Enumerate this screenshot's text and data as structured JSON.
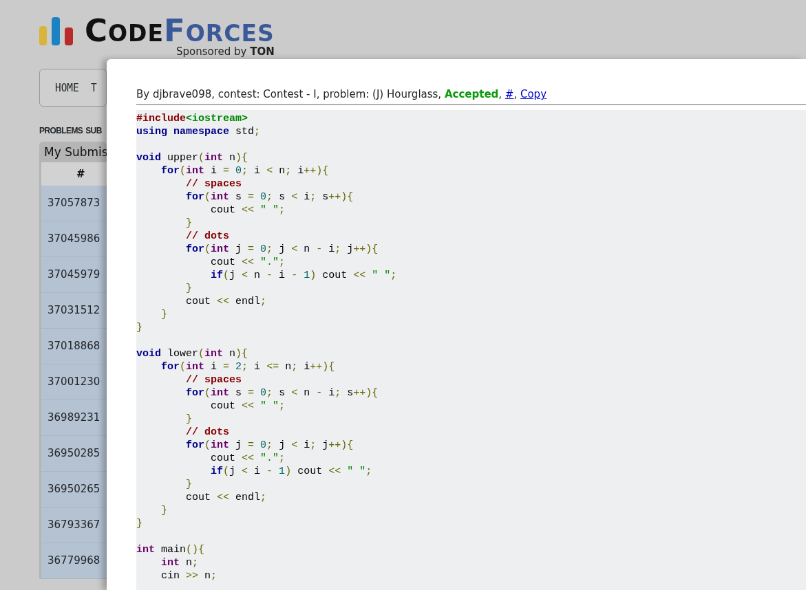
{
  "logo": {
    "word_dark": "CODE",
    "word_blue": "FORCES",
    "sponsor_prefix": "Sponsored by",
    "sponsor_name": "TON"
  },
  "menu": [
    {
      "label": "HOME"
    },
    {
      "label": "T"
    }
  ],
  "submenu": [
    {
      "label": "PROBLEMS"
    },
    {
      "label": "SUB"
    }
  ],
  "submissions": {
    "title": "My Submis",
    "columns": [
      "#"
    ],
    "rows": [
      {
        "id": "37057873"
      },
      {
        "id": "37045986"
      },
      {
        "id": "37045979"
      },
      {
        "id": "37031512"
      },
      {
        "id": "37018868"
      },
      {
        "id": "37001230"
      },
      {
        "id": "36989231"
      },
      {
        "id": "36950285"
      },
      {
        "id": "36950265"
      },
      {
        "id": "36793367"
      },
      {
        "id": "36779968"
      }
    ]
  },
  "modal": {
    "info": [
      {
        "kind": "text",
        "text": "By djbrave098, contest: Contest - I, problem: (J) Hourglass,"
      },
      {
        "kind": "verdict",
        "text": "Accepted"
      },
      {
        "kind": "text",
        "text": ","
      },
      {
        "kind": "link",
        "text": "#"
      },
      {
        "kind": "text",
        "text": ","
      },
      {
        "kind": "link",
        "text": "Copy"
      }
    ],
    "code": [
      {
        "kind": "code",
        "tokens": [
          {
            "kind": "pp",
            "text": "#include"
          },
          {
            "kind": "inc",
            "text": "<iostream>"
          }
        ]
      },
      {
        "kind": "code",
        "tokens": [
          {
            "kind": "kw",
            "text": "using namespace"
          },
          {
            "kind": "pln",
            "text": " std"
          },
          {
            "kind": "pun",
            "text": ";"
          }
        ]
      },
      {
        "kind": "blank"
      },
      {
        "kind": "code",
        "tokens": [
          {
            "kind": "kw",
            "text": "void"
          },
          {
            "kind": "pln",
            "text": " upper"
          },
          {
            "kind": "pun",
            "text": "("
          },
          {
            "kind": "typ",
            "text": "int"
          },
          {
            "kind": "pln",
            "text": " n"
          },
          {
            "kind": "pun",
            "text": "){"
          }
        ]
      },
      {
        "kind": "code",
        "tokens": [
          {
            "kind": "kw",
            "text": "    for"
          },
          {
            "kind": "pun",
            "text": "("
          },
          {
            "kind": "typ",
            "text": "int"
          },
          {
            "kind": "pln",
            "text": " i "
          },
          {
            "kind": "pun",
            "text": "="
          },
          {
            "kind": "num",
            "text": " 0"
          },
          {
            "kind": "pun",
            "text": ";"
          },
          {
            "kind": "pln",
            "text": " i "
          },
          {
            "kind": "pun",
            "text": "<"
          },
          {
            "kind": "pln",
            "text": " n"
          },
          {
            "kind": "pun",
            "text": ";"
          },
          {
            "kind": "pln",
            "text": " i"
          },
          {
            "kind": "pun",
            "text": "++){"
          }
        ]
      },
      {
        "kind": "code",
        "tokens": [
          {
            "kind": "com",
            "text": "        // spaces"
          }
        ]
      },
      {
        "kind": "code",
        "tokens": [
          {
            "kind": "kw",
            "text": "        for"
          },
          {
            "kind": "pun",
            "text": "("
          },
          {
            "kind": "typ",
            "text": "int"
          },
          {
            "kind": "pln",
            "text": " s "
          },
          {
            "kind": "pun",
            "text": "="
          },
          {
            "kind": "num",
            "text": " 0"
          },
          {
            "kind": "pun",
            "text": ";"
          },
          {
            "kind": "pln",
            "text": " s "
          },
          {
            "kind": "pun",
            "text": "<"
          },
          {
            "kind": "pln",
            "text": " i"
          },
          {
            "kind": "pun",
            "text": ";"
          },
          {
            "kind": "pln",
            "text": " s"
          },
          {
            "kind": "pun",
            "text": "++){"
          }
        ]
      },
      {
        "kind": "code",
        "tokens": [
          {
            "kind": "pln",
            "text": "            cout "
          },
          {
            "kind": "pun",
            "text": "<<"
          },
          {
            "kind": "str",
            "text": " \" \""
          },
          {
            "kind": "pun",
            "text": ";"
          }
        ]
      },
      {
        "kind": "code",
        "tokens": [
          {
            "kind": "pun",
            "text": "        }"
          }
        ]
      },
      {
        "kind": "code",
        "tokens": [
          {
            "kind": "com",
            "text": "        // dots"
          }
        ]
      },
      {
        "kind": "code",
        "tokens": [
          {
            "kind": "kw",
            "text": "        for"
          },
          {
            "kind": "pun",
            "text": "("
          },
          {
            "kind": "typ",
            "text": "int"
          },
          {
            "kind": "pln",
            "text": " j "
          },
          {
            "kind": "pun",
            "text": "="
          },
          {
            "kind": "num",
            "text": " 0"
          },
          {
            "kind": "pun",
            "text": ";"
          },
          {
            "kind": "pln",
            "text": " j "
          },
          {
            "kind": "pun",
            "text": "<"
          },
          {
            "kind": "pln",
            "text": " n "
          },
          {
            "kind": "pun",
            "text": "-"
          },
          {
            "kind": "pln",
            "text": " i"
          },
          {
            "kind": "pun",
            "text": ";"
          },
          {
            "kind": "pln",
            "text": " j"
          },
          {
            "kind": "pun",
            "text": "++){"
          }
        ]
      },
      {
        "kind": "code",
        "tokens": [
          {
            "kind": "pln",
            "text": "            cout "
          },
          {
            "kind": "pun",
            "text": "<<"
          },
          {
            "kind": "str",
            "text": " \".\""
          },
          {
            "kind": "pun",
            "text": ";"
          }
        ]
      },
      {
        "kind": "code",
        "tokens": [
          {
            "kind": "kw",
            "text": "            if"
          },
          {
            "kind": "pun",
            "text": "("
          },
          {
            "kind": "pln",
            "text": "j "
          },
          {
            "kind": "pun",
            "text": "<"
          },
          {
            "kind": "pln",
            "text": " n "
          },
          {
            "kind": "pun",
            "text": "-"
          },
          {
            "kind": "pln",
            "text": " i "
          },
          {
            "kind": "pun",
            "text": "-"
          },
          {
            "kind": "num",
            "text": " 1"
          },
          {
            "kind": "pun",
            "text": ")"
          },
          {
            "kind": "pln",
            "text": " cout "
          },
          {
            "kind": "pun",
            "text": "<<"
          },
          {
            "kind": "str",
            "text": " \" \""
          },
          {
            "kind": "pun",
            "text": ";"
          }
        ]
      },
      {
        "kind": "code",
        "tokens": [
          {
            "kind": "pun",
            "text": "        }"
          }
        ]
      },
      {
        "kind": "code",
        "tokens": [
          {
            "kind": "pln",
            "text": "        cout "
          },
          {
            "kind": "pun",
            "text": "<<"
          },
          {
            "kind": "pln",
            "text": " endl"
          },
          {
            "kind": "pun",
            "text": ";"
          }
        ]
      },
      {
        "kind": "code",
        "tokens": [
          {
            "kind": "pun",
            "text": "    }"
          }
        ]
      },
      {
        "kind": "code",
        "tokens": [
          {
            "kind": "pun",
            "text": "}"
          }
        ]
      },
      {
        "kind": "blank"
      },
      {
        "kind": "code",
        "tokens": [
          {
            "kind": "kw",
            "text": "void"
          },
          {
            "kind": "pln",
            "text": " lower"
          },
          {
            "kind": "pun",
            "text": "("
          },
          {
            "kind": "typ",
            "text": "int"
          },
          {
            "kind": "pln",
            "text": " n"
          },
          {
            "kind": "pun",
            "text": "){"
          }
        ]
      },
      {
        "kind": "code",
        "tokens": [
          {
            "kind": "kw",
            "text": "    for"
          },
          {
            "kind": "pun",
            "text": "("
          },
          {
            "kind": "typ",
            "text": "int"
          },
          {
            "kind": "pln",
            "text": " i "
          },
          {
            "kind": "pun",
            "text": "="
          },
          {
            "kind": "num",
            "text": " 2"
          },
          {
            "kind": "pun",
            "text": ";"
          },
          {
            "kind": "pln",
            "text": " i "
          },
          {
            "kind": "pun",
            "text": "<="
          },
          {
            "kind": "pln",
            "text": " n"
          },
          {
            "kind": "pun",
            "text": ";"
          },
          {
            "kind": "pln",
            "text": " i"
          },
          {
            "kind": "pun",
            "text": "++){"
          }
        ]
      },
      {
        "kind": "code",
        "tokens": [
          {
            "kind": "com",
            "text": "        // spaces"
          }
        ]
      },
      {
        "kind": "code",
        "tokens": [
          {
            "kind": "kw",
            "text": "        for"
          },
          {
            "kind": "pun",
            "text": "("
          },
          {
            "kind": "typ",
            "text": "int"
          },
          {
            "kind": "pln",
            "text": " s "
          },
          {
            "kind": "pun",
            "text": "="
          },
          {
            "kind": "num",
            "text": " 0"
          },
          {
            "kind": "pun",
            "text": ";"
          },
          {
            "kind": "pln",
            "text": " s "
          },
          {
            "kind": "pun",
            "text": "<"
          },
          {
            "kind": "pln",
            "text": " n "
          },
          {
            "kind": "pun",
            "text": "-"
          },
          {
            "kind": "pln",
            "text": " i"
          },
          {
            "kind": "pun",
            "text": ";"
          },
          {
            "kind": "pln",
            "text": " s"
          },
          {
            "kind": "pun",
            "text": "++){"
          }
        ]
      },
      {
        "kind": "code",
        "tokens": [
          {
            "kind": "pln",
            "text": "            cout "
          },
          {
            "kind": "pun",
            "text": "<<"
          },
          {
            "kind": "str",
            "text": " \" \""
          },
          {
            "kind": "pun",
            "text": ";"
          }
        ]
      },
      {
        "kind": "code",
        "tokens": [
          {
            "kind": "pun",
            "text": "        }"
          }
        ]
      },
      {
        "kind": "code",
        "tokens": [
          {
            "kind": "com",
            "text": "        // dots"
          }
        ]
      },
      {
        "kind": "code",
        "tokens": [
          {
            "kind": "kw",
            "text": "        for"
          },
          {
            "kind": "pun",
            "text": "("
          },
          {
            "kind": "typ",
            "text": "int"
          },
          {
            "kind": "pln",
            "text": " j "
          },
          {
            "kind": "pun",
            "text": "="
          },
          {
            "kind": "num",
            "text": " 0"
          },
          {
            "kind": "pun",
            "text": ";"
          },
          {
            "kind": "pln",
            "text": " j "
          },
          {
            "kind": "pun",
            "text": "<"
          },
          {
            "kind": "pln",
            "text": " i"
          },
          {
            "kind": "pun",
            "text": ";"
          },
          {
            "kind": "pln",
            "text": " j"
          },
          {
            "kind": "pun",
            "text": "++){"
          }
        ]
      },
      {
        "kind": "code",
        "tokens": [
          {
            "kind": "pln",
            "text": "            cout "
          },
          {
            "kind": "pun",
            "text": "<<"
          },
          {
            "kind": "str",
            "text": " \".\""
          },
          {
            "kind": "pun",
            "text": ";"
          }
        ]
      },
      {
        "kind": "code",
        "tokens": [
          {
            "kind": "kw",
            "text": "            if"
          },
          {
            "kind": "pun",
            "text": "("
          },
          {
            "kind": "pln",
            "text": "j "
          },
          {
            "kind": "pun",
            "text": "<"
          },
          {
            "kind": "pln",
            "text": " i "
          },
          {
            "kind": "pun",
            "text": "-"
          },
          {
            "kind": "num",
            "text": " 1"
          },
          {
            "kind": "pun",
            "text": ")"
          },
          {
            "kind": "pln",
            "text": " cout "
          },
          {
            "kind": "pun",
            "text": "<<"
          },
          {
            "kind": "str",
            "text": " \" \""
          },
          {
            "kind": "pun",
            "text": ";"
          }
        ]
      },
      {
        "kind": "code",
        "tokens": [
          {
            "kind": "pun",
            "text": "        }"
          }
        ]
      },
      {
        "kind": "code",
        "tokens": [
          {
            "kind": "pln",
            "text": "        cout "
          },
          {
            "kind": "pun",
            "text": "<<"
          },
          {
            "kind": "pln",
            "text": " endl"
          },
          {
            "kind": "pun",
            "text": ";"
          }
        ]
      },
      {
        "kind": "code",
        "tokens": [
          {
            "kind": "pun",
            "text": "    }"
          }
        ]
      },
      {
        "kind": "code",
        "tokens": [
          {
            "kind": "pun",
            "text": "}"
          }
        ]
      },
      {
        "kind": "blank"
      },
      {
        "kind": "code",
        "tokens": [
          {
            "kind": "typ",
            "text": "int"
          },
          {
            "kind": "pln",
            "text": " main"
          },
          {
            "kind": "pun",
            "text": "(){"
          }
        ]
      },
      {
        "kind": "code",
        "tokens": [
          {
            "kind": "typ",
            "text": "    int"
          },
          {
            "kind": "pln",
            "text": " n"
          },
          {
            "kind": "pun",
            "text": ";"
          }
        ]
      },
      {
        "kind": "code",
        "tokens": [
          {
            "kind": "pln",
            "text": "    cin "
          },
          {
            "kind": "pun",
            "text": ">>"
          },
          {
            "kind": "pln",
            "text": " n"
          },
          {
            "kind": "pun",
            "text": ";"
          }
        ]
      }
    ]
  }
}
